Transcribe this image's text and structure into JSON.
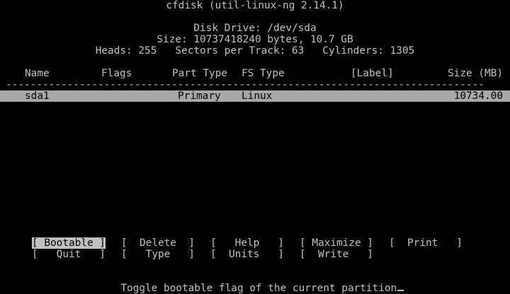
{
  "title": "cfdisk (util-linux-ng 2.14.1)",
  "disk": {
    "drive": "Disk Drive: /dev/sda",
    "size": "Size: 10737418240 bytes, 10.7 GB",
    "geometry": "Heads: 255   Sectors per Track: 63   Cylinders: 1305"
  },
  "table": {
    "columns": {
      "name": "Name",
      "flags": "Flags",
      "part_type": "Part Type",
      "fs_type": "FS Type",
      "label": "[Label]",
      "size": "Size (MB)"
    },
    "separator": "------------------------------------------------------------------------------",
    "rows": [
      {
        "name": "sda1",
        "flags": "",
        "part_type": "Primary",
        "fs_type": "Linux",
        "label": "",
        "size": "10734.00"
      }
    ]
  },
  "menu": {
    "row1": [
      "[ Bootable ]",
      "[  Delete  ]",
      "[   Help   ]",
      "[ Maximize ]",
      "[  Print   ]"
    ],
    "row2": [
      "[   Quit   ]",
      "[   Type   ]",
      "[  Units   ]",
      "[  Write   ]"
    ]
  },
  "status": "Toggle bootable flag of the current partition",
  "colors": {
    "background": "#000000",
    "foreground": "#c0c0c0",
    "highlight_bg": "#a8a8a8",
    "highlight_fg": "#000000"
  }
}
